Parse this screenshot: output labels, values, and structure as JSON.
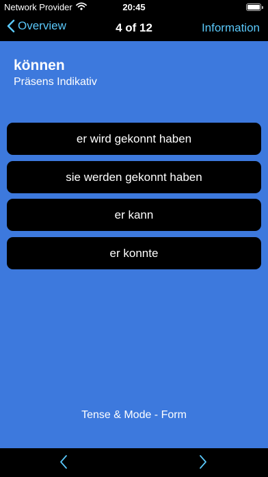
{
  "status_bar": {
    "carrier": "Network Provider",
    "time": "20:45",
    "battery_level": 1.0
  },
  "nav": {
    "back_label": "Overview",
    "title": "4 of 12",
    "info_label": "Information"
  },
  "question": {
    "verb": "können",
    "tense": "Präsens Indikativ"
  },
  "answers": [
    "er wird gekonnt haben",
    "sie werden gekonnt haben",
    "er kann",
    "er konnte"
  ],
  "footer_label": "Tense & Mode - Form",
  "icons": {
    "wifi": "wifi-icon",
    "battery": "battery-icon",
    "back": "chevron-left-icon",
    "prev": "chevron-left-icon",
    "next": "chevron-right-icon"
  },
  "colors": {
    "accent": "#5ac8fa",
    "background": "#3d79dd",
    "card": "#000000"
  }
}
